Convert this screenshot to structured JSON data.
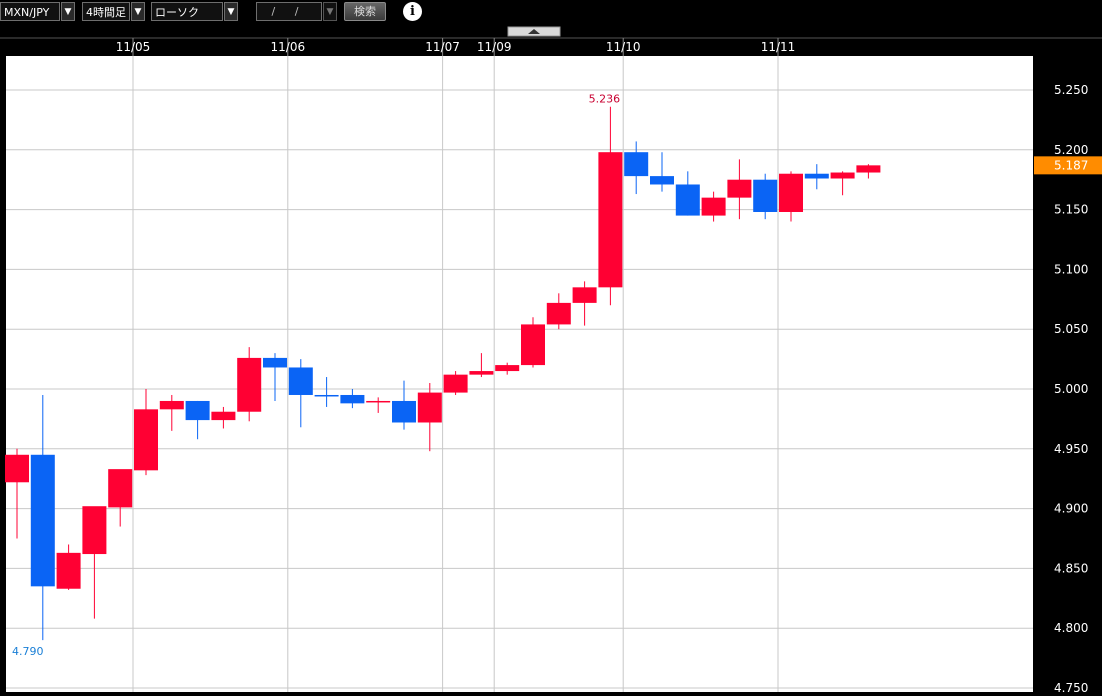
{
  "toolbar": {
    "pair": "MXN/JPY",
    "timeframe": "4時間足",
    "chart_type": "ローソク(BID)",
    "date": "/ /",
    "search": "検索",
    "dropdown_arrow": "▼",
    "info": "i"
  },
  "colors": {
    "up": "#ff0033",
    "down": "#0a64f5",
    "neutral": "#c8a000",
    "price_tag": "#ff8c00",
    "grid": "#c8c8c8",
    "plot_bg": "#ffffff",
    "high_label": "#c80030",
    "low_label": "#1a7fd6"
  },
  "chart_data": {
    "type": "candlestick",
    "title": "",
    "ylim": [
      4.75,
      5.28
    ],
    "y_ticks": [
      "5.250",
      "5.200",
      "5.150",
      "5.100",
      "5.050",
      "5.000",
      "4.950",
      "4.900",
      "4.850",
      "4.800",
      "4.750"
    ],
    "date_labels": [
      {
        "label": "11/05",
        "index": 5
      },
      {
        "label": "11/06",
        "index": 11
      },
      {
        "label": "11/07",
        "index": 17
      },
      {
        "label": "11/09",
        "index": 19
      },
      {
        "label": "11/10",
        "index": 24
      },
      {
        "label": "11/11",
        "index": 30
      }
    ],
    "candles": [
      {
        "o": 4.922,
        "h": 4.95,
        "l": 4.875,
        "c": 4.945
      },
      {
        "o": 4.945,
        "h": 4.995,
        "l": 4.79,
        "c": 4.835
      },
      {
        "o": 4.833,
        "h": 4.87,
        "l": 4.832,
        "c": 4.863
      },
      {
        "o": 4.862,
        "h": 4.9,
        "l": 4.808,
        "c": 4.902
      },
      {
        "o": 4.901,
        "h": 4.92,
        "l": 4.885,
        "c": 4.933
      },
      {
        "o": 4.932,
        "h": 5.0,
        "l": 4.928,
        "c": 4.983
      },
      {
        "o": 4.983,
        "h": 4.995,
        "l": 4.965,
        "c": 4.99
      },
      {
        "o": 4.99,
        "h": 4.99,
        "l": 4.958,
        "c": 4.974
      },
      {
        "o": 4.974,
        "h": 4.985,
        "l": 4.967,
        "c": 4.981
      },
      {
        "o": 4.981,
        "h": 5.035,
        "l": 4.973,
        "c": 5.026
      },
      {
        "o": 5.026,
        "h": 5.03,
        "l": 4.99,
        "c": 5.018
      },
      {
        "o": 5.018,
        "h": 5.025,
        "l": 4.968,
        "c": 4.995
      },
      {
        "o": 4.995,
        "h": 5.01,
        "l": 4.985,
        "c": 4.994
      },
      {
        "o": 4.995,
        "h": 5.0,
        "l": 4.984,
        "c": 4.988
      },
      {
        "o": 4.989,
        "h": 4.993,
        "l": 4.98,
        "c": 4.99
      },
      {
        "o": 4.99,
        "h": 5.007,
        "l": 4.966,
        "c": 4.972
      },
      {
        "o": 4.972,
        "h": 5.005,
        "l": 4.948,
        "c": 4.997
      },
      {
        "o": 4.997,
        "h": 5.015,
        "l": 4.995,
        "c": 5.012
      },
      {
        "o": 5.012,
        "h": 5.03,
        "l": 5.01,
        "c": 5.015
      },
      {
        "o": 5.015,
        "h": 5.022,
        "l": 5.012,
        "c": 5.02
      },
      {
        "o": 5.02,
        "h": 5.06,
        "l": 5.018,
        "c": 5.054
      },
      {
        "o": 5.054,
        "h": 5.08,
        "l": 5.05,
        "c": 5.072
      },
      {
        "o": 5.072,
        "h": 5.09,
        "l": 5.053,
        "c": 5.085
      },
      {
        "o": 5.085,
        "h": 5.236,
        "l": 5.07,
        "c": 5.198
      },
      {
        "o": 5.198,
        "h": 5.207,
        "l": 5.163,
        "c": 5.178
      },
      {
        "o": 5.178,
        "h": 5.198,
        "l": 5.165,
        "c": 5.171
      },
      {
        "o": 5.171,
        "h": 5.182,
        "l": 5.145,
        "c": 5.145
      },
      {
        "o": 5.145,
        "h": 5.165,
        "l": 5.14,
        "c": 5.16
      },
      {
        "o": 5.16,
        "h": 5.192,
        "l": 5.142,
        "c": 5.175
      },
      {
        "o": 5.175,
        "h": 5.18,
        "l": 5.142,
        "c": 5.148
      },
      {
        "o": 5.148,
        "h": 5.182,
        "l": 5.14,
        "c": 5.18
      },
      {
        "o": 5.18,
        "h": 5.188,
        "l": 5.167,
        "c": 5.176
      },
      {
        "o": 5.176,
        "h": 5.182,
        "l": 5.162,
        "c": 5.181
      },
      {
        "o": 5.181,
        "h": 5.188,
        "l": 5.176,
        "c": 5.187
      }
    ],
    "high_label": {
      "value": "5.236",
      "index": 23
    },
    "low_label": {
      "value": "4.790",
      "index": 1
    },
    "current_price": "5.187"
  }
}
